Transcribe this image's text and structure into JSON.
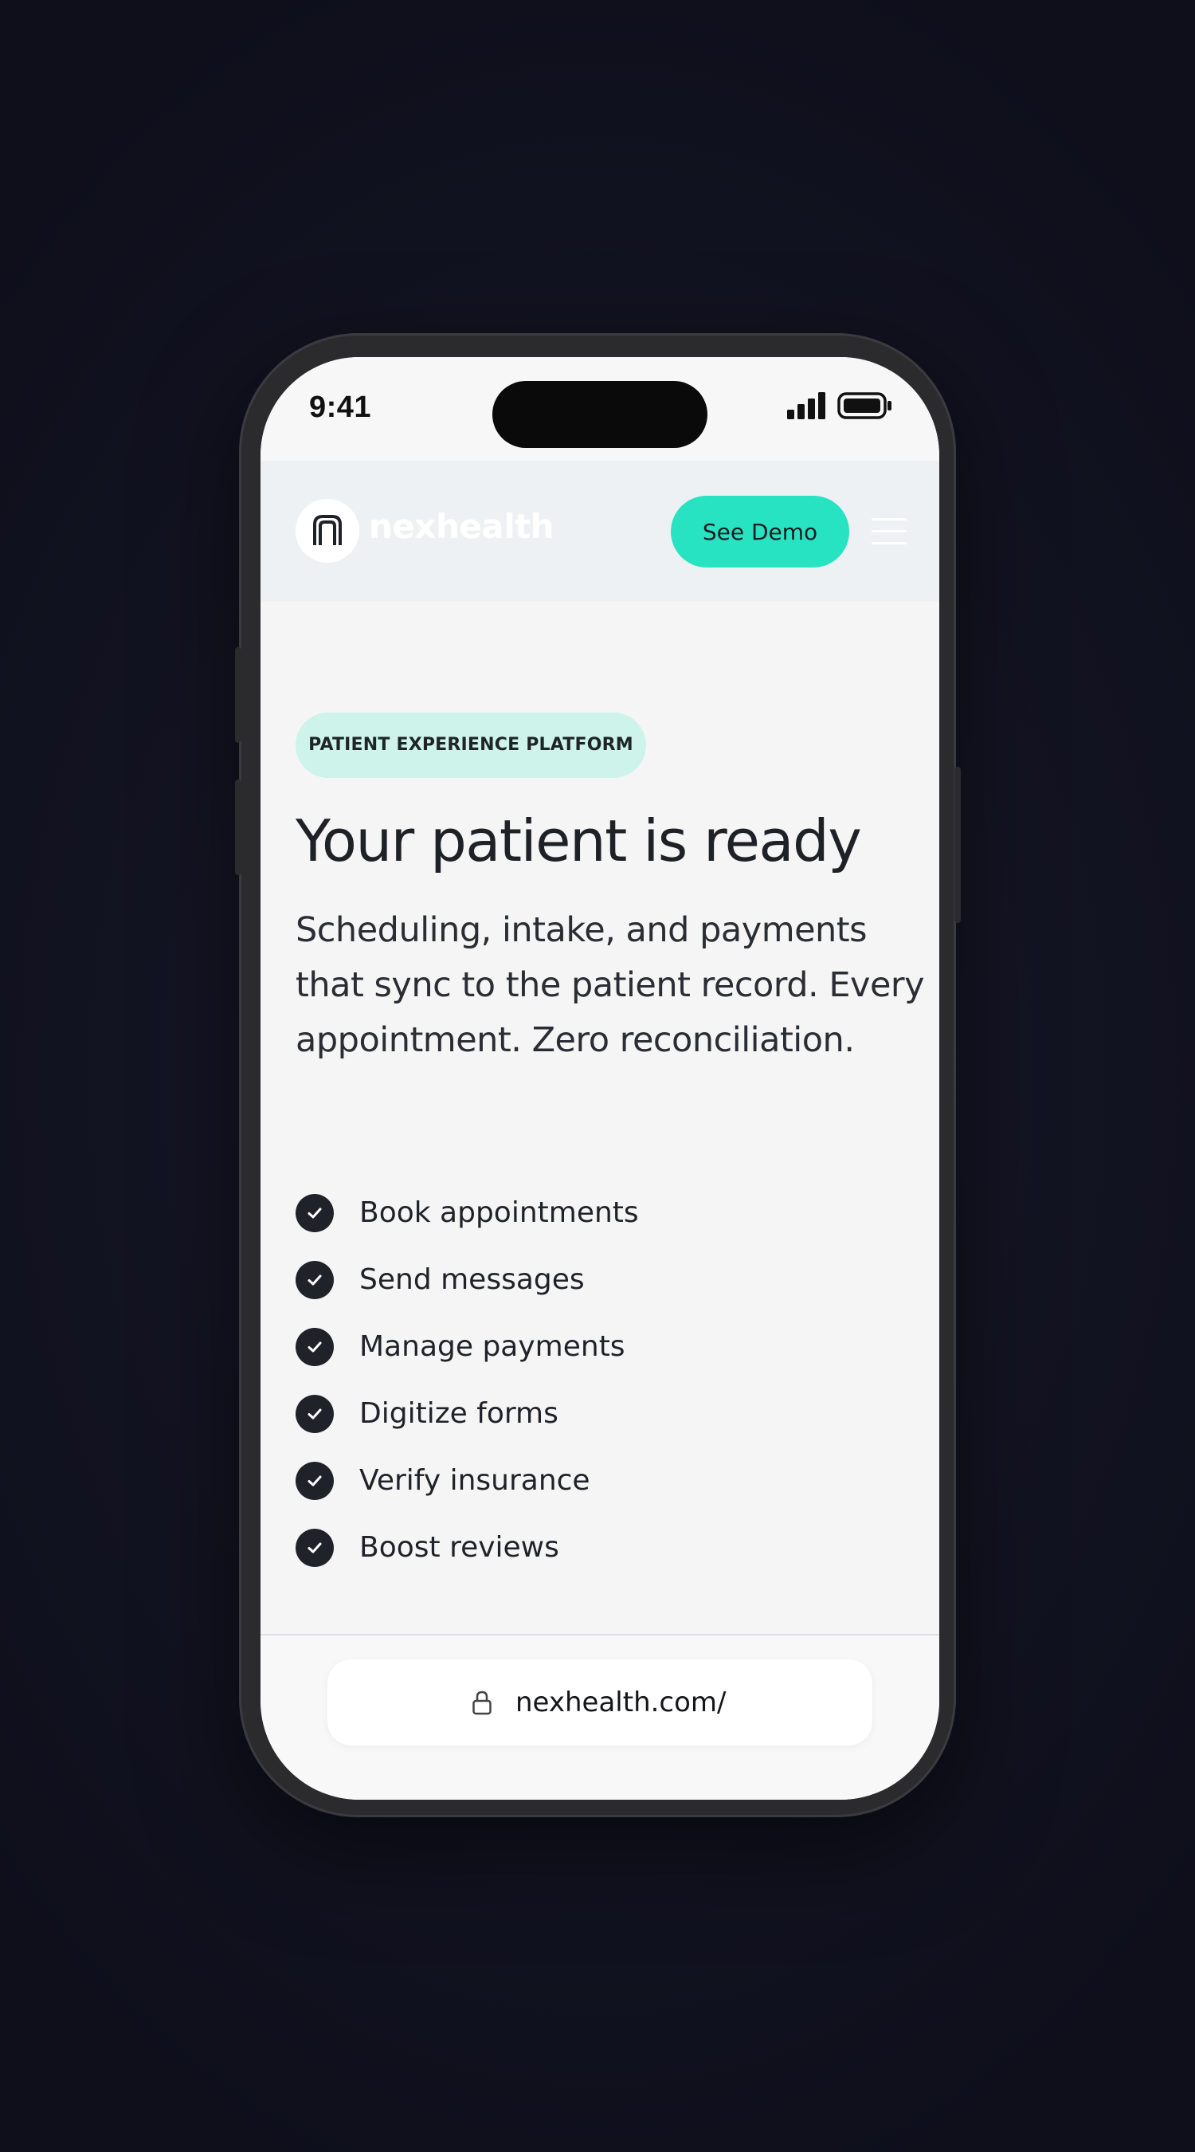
{
  "status_bar": {
    "time": "9:41"
  },
  "header": {
    "logo_text": "nexhealth",
    "cta_label": "See Demo"
  },
  "hero": {
    "badge": "PATIENT EXPERIENCE PLATFORM",
    "headline": "Your patient is ready",
    "subtext": "Scheduling, intake, and payments that sync to the patient record. Every appointment. Zero reconciliation."
  },
  "features": [
    "Book appointments",
    "Send messages",
    "Manage payments",
    "Digitize forms",
    "Verify insurance",
    "Boost reviews"
  ],
  "browser": {
    "url": "nexhealth.com/"
  },
  "colors": {
    "accent": "#28e3c2",
    "badge_bg": "#cdf3ea",
    "text_dark": "#1e2126",
    "page_bg": "#0e0f1b"
  },
  "icons": [
    "logo-icon",
    "signal-icon",
    "battery-icon",
    "menu-icon",
    "check-icon",
    "lock-icon"
  ]
}
